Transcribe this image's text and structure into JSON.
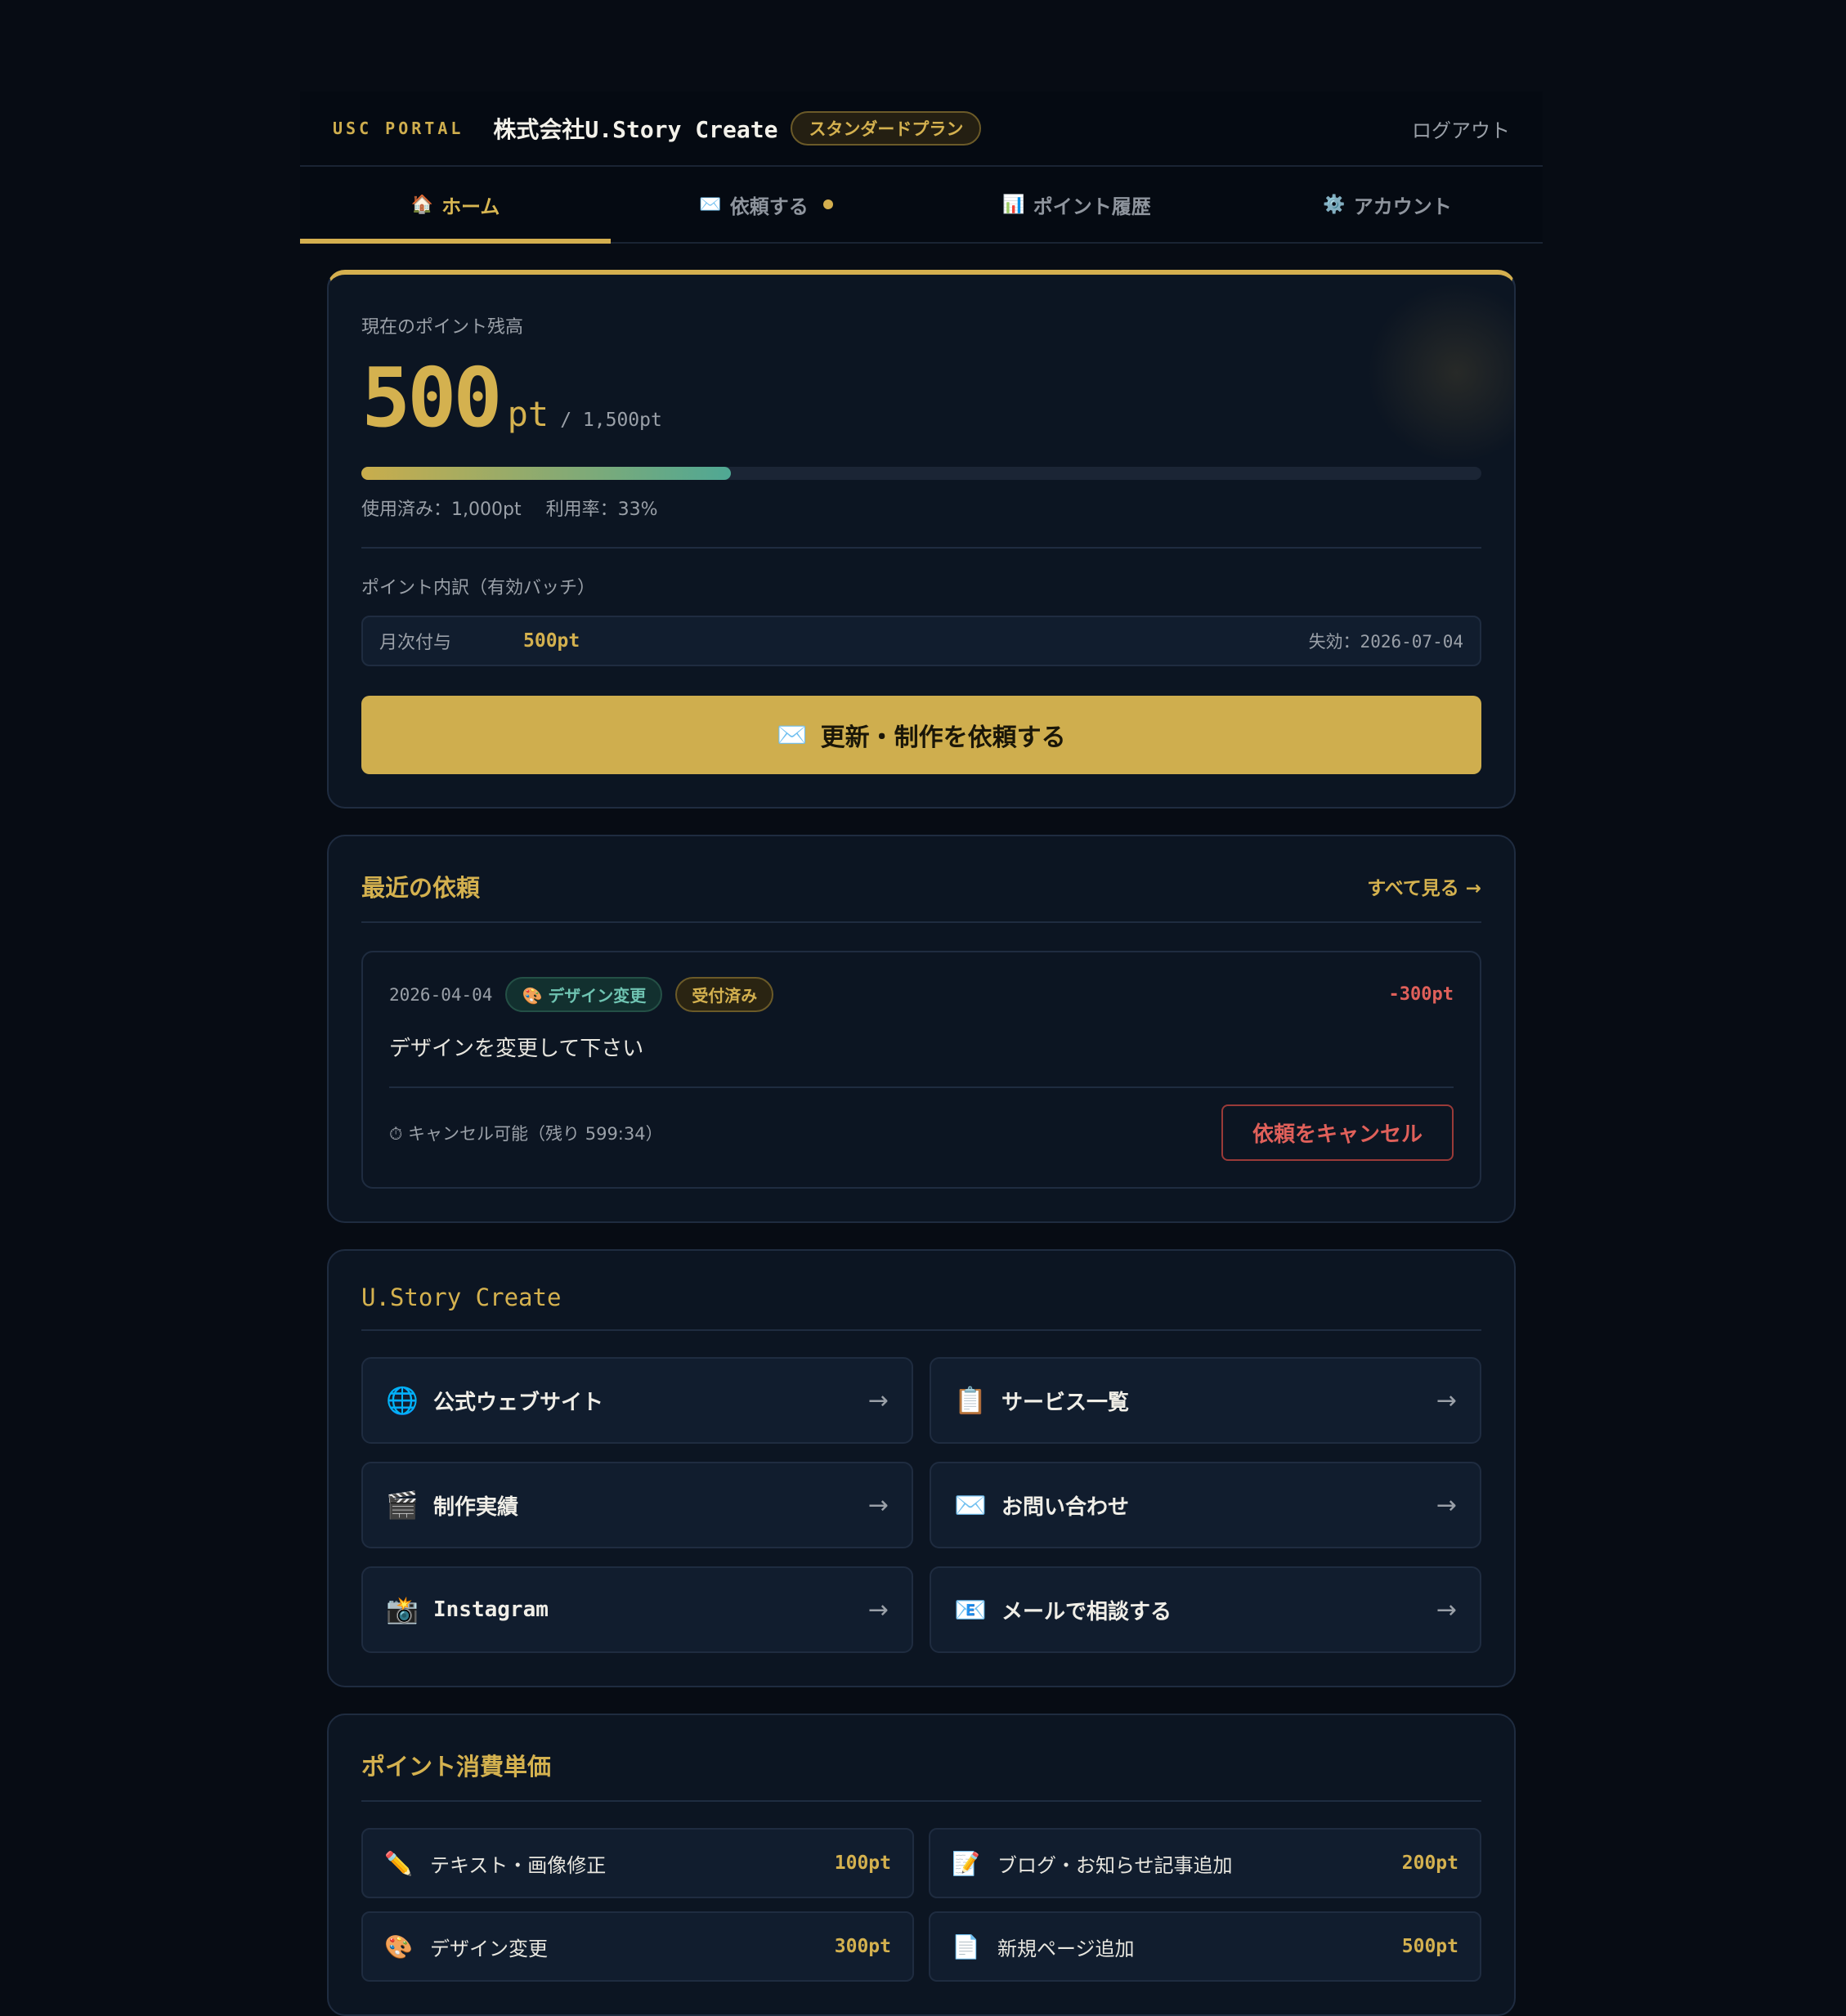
{
  "header": {
    "brand": "USC PORTAL",
    "company": "株式会社U.Story Create",
    "plan": "スタンダードプラン",
    "logout": "ログアウト"
  },
  "tabs": [
    {
      "icon": "🏠",
      "label": "ホーム",
      "active": true
    },
    {
      "icon": "✉️",
      "label": "依頼する",
      "has_dot": true
    },
    {
      "icon": "📊",
      "label": "ポイント履歴"
    },
    {
      "icon": "⚙️",
      "label": "アカウント"
    }
  ],
  "points": {
    "label": "現在のポイント残高",
    "balance": "500",
    "unit": "pt",
    "total": "/ 1,500pt",
    "usage_fraction": 0.33,
    "used": "使用済み：1,000pt",
    "rate": "利用率：33%",
    "breakdown_label": "ポイント内訳（有効バッチ）",
    "batch": {
      "name": "月次付与",
      "points": "500pt",
      "expiry": "失効：2026-07-04"
    },
    "cta_icon": "✉️",
    "cta": "更新・制作を依頼する"
  },
  "recent": {
    "title": "最近の依頼",
    "see_all": "すべて見る →",
    "item": {
      "date": "2026-04-04",
      "category_icon": "🎨",
      "category": "デザイン変更",
      "status": "受付済み",
      "cost": "-300pt",
      "body": "デザインを変更して下さい",
      "cancel_note": "⏱ キャンセル可能（残り 599:34）",
      "cancel_button": "依頼をキャンセル"
    }
  },
  "links": {
    "title": "U.Story Create",
    "items": [
      {
        "icon": "🌐",
        "label": "公式ウェブサイト"
      },
      {
        "icon": "📋",
        "label": "サービス一覧"
      },
      {
        "icon": "🎬",
        "label": "制作実績"
      },
      {
        "icon": "✉️",
        "label": "お問い合わせ"
      },
      {
        "icon": "📸",
        "label": "Instagram"
      },
      {
        "icon": "📧",
        "label": "メールで相談する"
      }
    ],
    "arrow": "→"
  },
  "prices": {
    "title": "ポイント消費単価",
    "items": [
      {
        "icon": "✏️",
        "label": "テキスト・画像修正",
        "value": "100pt"
      },
      {
        "icon": "📝",
        "label": "ブログ・お知らせ記事追加",
        "value": "200pt"
      },
      {
        "icon": "🎨",
        "label": "デザイン変更",
        "value": "300pt"
      },
      {
        "icon": "📄",
        "label": "新規ページ追加",
        "value": "500pt"
      }
    ]
  }
}
